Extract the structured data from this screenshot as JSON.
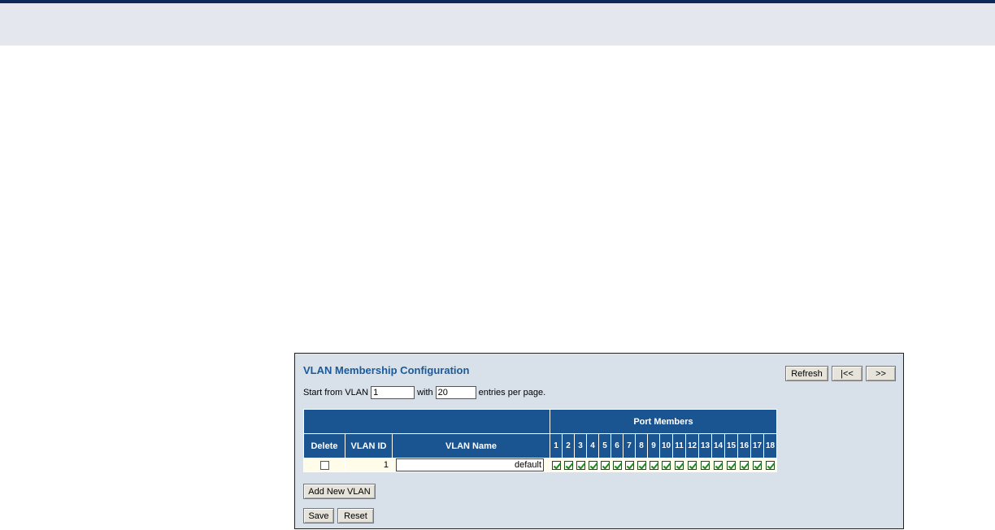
{
  "title": "VLAN Membership Configuration",
  "buttons": {
    "refresh": "Refresh",
    "first": "|<<",
    "next": ">>",
    "add_new": "Add New VLAN",
    "save": "Save",
    "reset": "Reset"
  },
  "start": {
    "prefix": "Start from VLAN",
    "vlan_value": "1",
    "with_label": "with",
    "entries_value": "20",
    "suffix": "entries per page."
  },
  "table": {
    "port_members_header": "Port Members",
    "headers": {
      "delete": "Delete",
      "vlan_id": "VLAN ID",
      "vlan_name": "VLAN Name"
    },
    "ports": [
      "1",
      "2",
      "3",
      "4",
      "5",
      "6",
      "7",
      "8",
      "9",
      "10",
      "11",
      "12",
      "13",
      "14",
      "15",
      "16",
      "17",
      "18"
    ],
    "rows": [
      {
        "delete": false,
        "vlan_id": "1",
        "vlan_name": "default",
        "members": [
          true,
          true,
          true,
          true,
          true,
          true,
          true,
          true,
          true,
          true,
          true,
          true,
          true,
          true,
          true,
          true,
          true,
          true
        ]
      }
    ]
  }
}
